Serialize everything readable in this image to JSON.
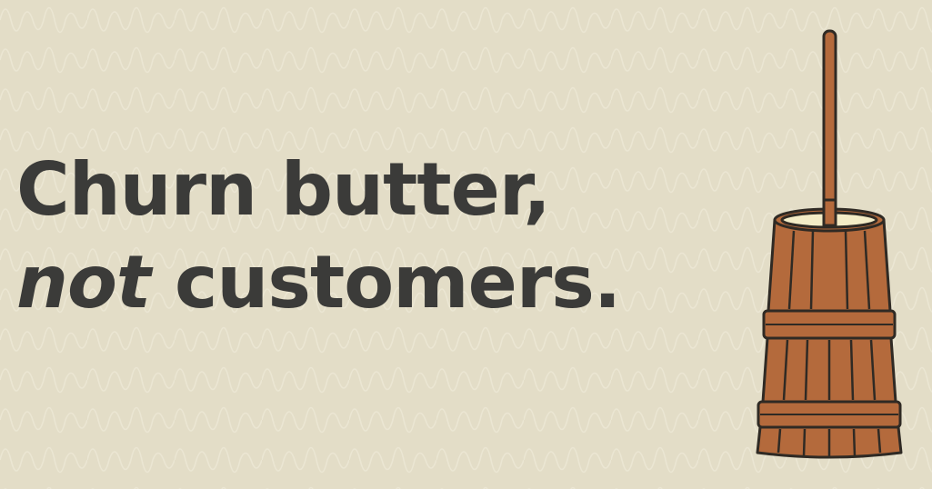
{
  "headline": {
    "line1": "Churn butter,",
    "line2_emphasis": "not",
    "line2_rest": " customers."
  },
  "illustration": {
    "icon": "butter-churn-icon",
    "wood_color": "#b46a3c",
    "outline_color": "#2f2a24",
    "cream_color": "#f3ecc6"
  },
  "colors": {
    "background": "#e3ddc7",
    "pattern": "#ebe6d3",
    "text": "#3b3b39"
  }
}
